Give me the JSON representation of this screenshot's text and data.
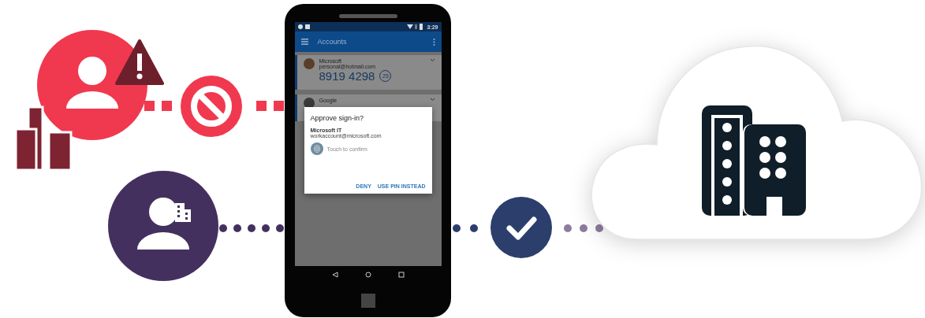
{
  "phone": {
    "status_time": "3:29",
    "app_bar": {
      "title": "Accounts"
    },
    "accounts": [
      {
        "name": "Microsoft",
        "email": "personal@hotmail.com",
        "code": "8919 4298",
        "timer": "25"
      },
      {
        "name": "Google"
      }
    ],
    "dialog": {
      "title": "Approve sign-in?",
      "org": "Microsoft IT",
      "account": "workaccount@microsoft.com",
      "hint": "Touch to confirm",
      "buttons": [
        "DENY",
        "USE PIN INSTEAD"
      ]
    }
  }
}
